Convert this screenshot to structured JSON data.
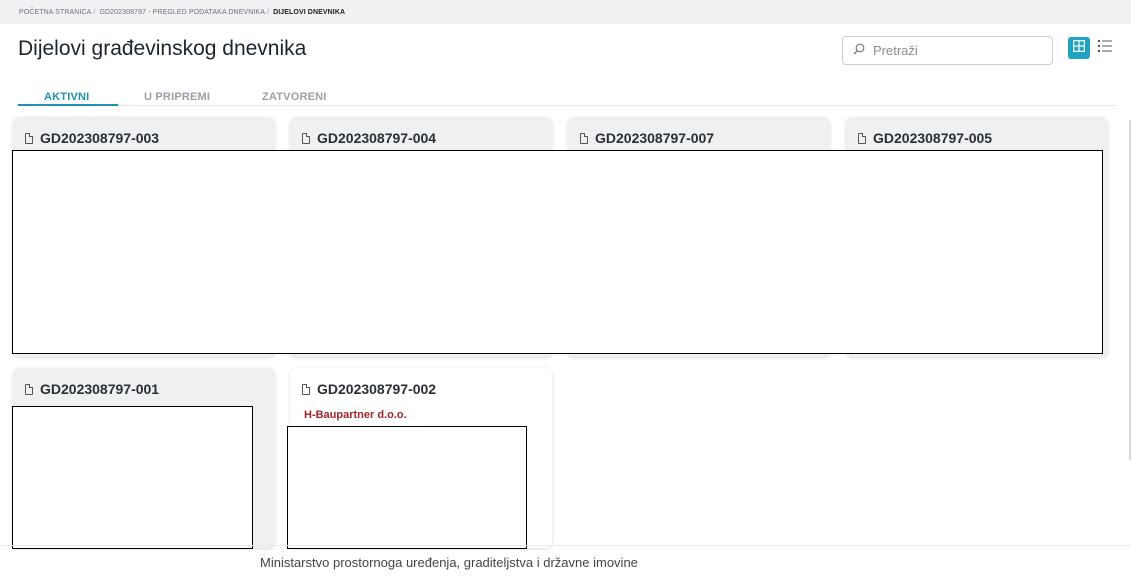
{
  "breadcrumb": {
    "items": [
      "POČETNA STRANICA",
      "GD202308797 - PREGLED PODATAKA DNEVNIKA"
    ],
    "current": "DIJELOVI DNEVNIKA"
  },
  "page": {
    "title": "Dijelovi građevinskog dnevnika"
  },
  "search": {
    "placeholder": "Pretraži"
  },
  "view_toggle": {
    "active": "grid",
    "icons": [
      "grid-view-icon",
      "list-view-icon"
    ]
  },
  "tabs": [
    {
      "label": "AKTIVNI",
      "active": true
    },
    {
      "label": "U PRIPREMI",
      "active": false
    },
    {
      "label": "ZATVORENI",
      "active": false
    }
  ],
  "cards": [
    {
      "title": "GD202308797-003"
    },
    {
      "title": "GD202308797-004"
    },
    {
      "title": "GD202308797-007"
    },
    {
      "title": "GD202308797-005"
    },
    {
      "title": "GD202308797-001"
    },
    {
      "title": "GD202308797-002",
      "company": "H-Baupartner d.o.o."
    }
  ],
  "footer": {
    "text": "Ministarstvo prostornoga uređenja, graditeljstva i državne imovine"
  },
  "colors": {
    "accent": "#1f8fb3",
    "company_red": "#a0252b",
    "grid_button": "#1fa3c0"
  }
}
